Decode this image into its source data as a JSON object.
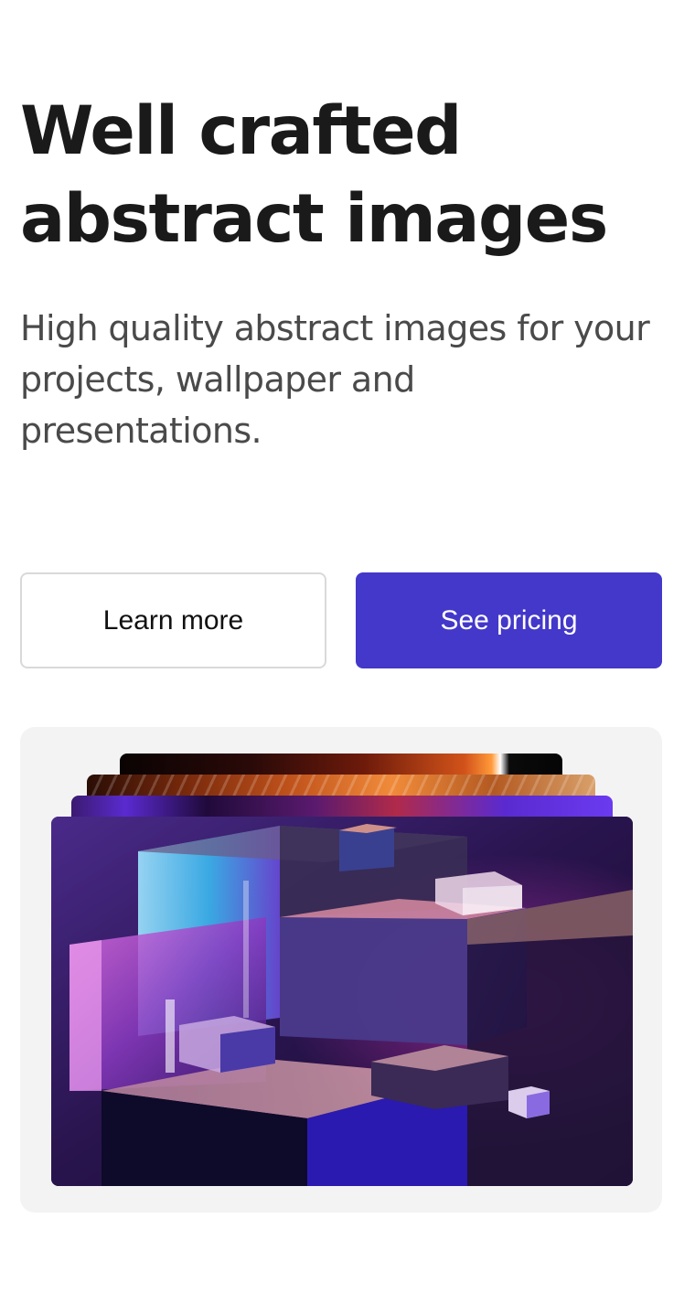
{
  "hero": {
    "title_lines": [
      "Well crafted",
      "abstract images"
    ],
    "subtitle_lines": [
      "High quality abstract images for your",
      "projects, wallpaper and",
      "presentations."
    ]
  },
  "actions": {
    "learn_more_label": "Learn more",
    "see_pricing_label": "See pricing"
  },
  "colors": {
    "primary": "#4338ca",
    "heading": "#1a1a1a",
    "body_text": "#4a4a4a",
    "showcase_bg": "#f3f3f4"
  }
}
